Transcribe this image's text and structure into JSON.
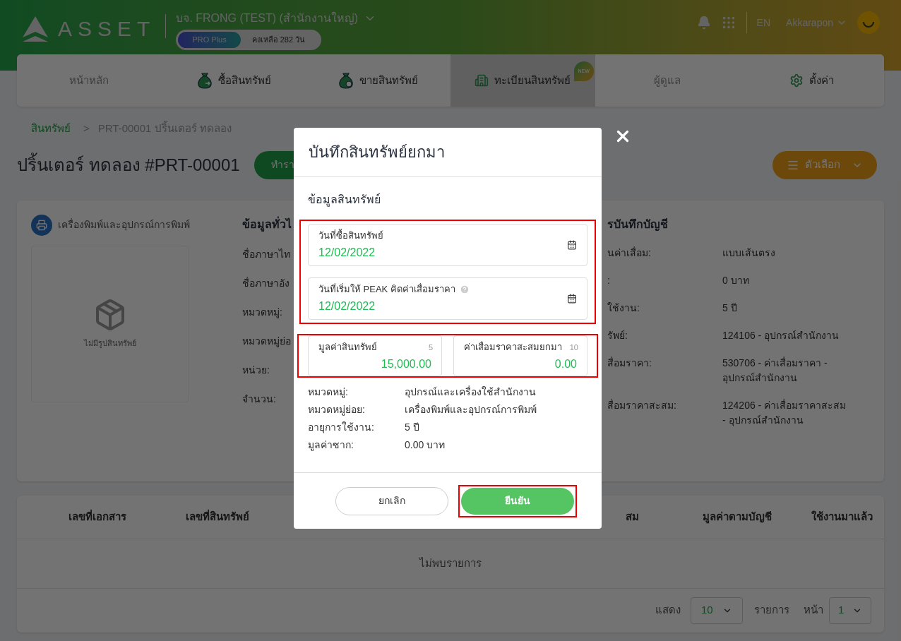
{
  "header": {
    "logo_text": "ASSET",
    "company": "บจ. FRONG (TEST) (สำนักงานใหญ่)",
    "plan": "PRO Plus",
    "remaining": "คงเหลือ 282 วัน",
    "language": "EN",
    "user": "Akkarapon"
  },
  "nav": {
    "tabs": [
      {
        "label": "หน้าหลัก",
        "kind": "plain",
        "selected": false,
        "disabled": true
      },
      {
        "label": "ซื้อสินทรัพย์",
        "kind": "buy",
        "selected": false,
        "disabled": false
      },
      {
        "label": "ขายสินทรัพย์",
        "kind": "sell",
        "selected": false,
        "disabled": false
      },
      {
        "label": "ทะเบียนสินทรัพย์",
        "kind": "register",
        "selected": true,
        "disabled": false,
        "badge": "NEW"
      },
      {
        "label": "ผู้ดูแล",
        "kind": "plain",
        "selected": false,
        "disabled": true
      },
      {
        "label": "ตั้งค่า",
        "kind": "settings",
        "selected": false,
        "disabled": false
      }
    ]
  },
  "breadcrumb": {
    "root": "สินทรัพย์",
    "separator": ">",
    "current": "PRT-00001 ปริ้นเตอร์ ทดลอง"
  },
  "page": {
    "title": "ปริ้นเตอร์ ทดลอง #PRT-00001",
    "action_button": "ทำรา",
    "options_button": "ตัวเลือก"
  },
  "asset_card": {
    "category": "เครื่องพิมพ์และอุปกรณ์การพิมพ์",
    "no_image": "ไม่มีรูปสินทรัพย์",
    "general": {
      "heading": "ข้อมูลทั่วไ",
      "labels": [
        "ชื่อภาษาไท",
        "ชื่อภาษาอัง",
        "หมวดหมู่:",
        "หมวดหมู่ย่อ",
        "หน่วย:",
        "จำนวน:"
      ]
    },
    "accounting": {
      "heading": "รบันทึกบัญชี",
      "rows": [
        {
          "label": "นค่าเสื่อม:",
          "value": "แบบเส้นตรง"
        },
        {
          "label": ":",
          "value": "0 บาท"
        },
        {
          "label": "ใช้งาน:",
          "value": "5 ปี"
        },
        {
          "label": "รัพย์:",
          "value": "124106 - อุปกรณ์สำนักงาน"
        },
        {
          "label": "สื่อมราคา:",
          "value": "530706 - ค่าเสื่อมราคา - อุปกรณ์สำนักงาน"
        },
        {
          "label": "สื่อมราคาสะสม:",
          "value": "124206 - ค่าเสื่อมราคาสะสม - อุปกรณ์สำนักงาน"
        }
      ]
    }
  },
  "table": {
    "columns": [
      "เลขที่เอกสาร",
      "เลขที่สินทรัพย์",
      "สม",
      "มูลค่าตามบัญชี",
      "ใช้งานมาแล้ว"
    ],
    "empty": "ไม่พบรายการ",
    "footer": {
      "show_label": "แสดง",
      "page_size": "10",
      "items_label": "รายการ",
      "page_label": "หน้า",
      "page": "1"
    }
  },
  "modal": {
    "title": "บันทึกสินทรัพย์ยกมา",
    "section": "ข้อมูลสินทรัพย์",
    "dates": {
      "highlighted": true,
      "fields": [
        {
          "label": "วันที่ซื้อสินทรัพย์",
          "value": "12/02/2022",
          "help": false
        },
        {
          "label": "วันที่เริ่มให้ PEAK คิดค่าเสื่อมราคา",
          "value": "12/02/2022",
          "help": true
        }
      ]
    },
    "amounts": {
      "highlighted": true,
      "fields": [
        {
          "label": "มูลค่าสินทรัพย์",
          "counter": "5",
          "value": "15,000.00"
        },
        {
          "label": "ค่าเสื่อมราคาสะสมยกมา",
          "counter": "10",
          "value": "0.00"
        }
      ]
    },
    "details": [
      {
        "label": "หมวดหมู่:",
        "value": "อุปกรณ์และเครื่องใช้สำนักงาน"
      },
      {
        "label": "หมวดหมู่ย่อย:",
        "value": "เครื่องพิมพ์และอุปกรณ์การพิมพ์"
      },
      {
        "label": "อายุการใช้งาน:",
        "value": "5 ปี"
      },
      {
        "label": "มูลค่าซาก:",
        "value": "0.00 บาท"
      }
    ],
    "cancel": "ยกเลิก",
    "confirm": {
      "label": "ยืนยัน",
      "highlighted": true
    }
  }
}
